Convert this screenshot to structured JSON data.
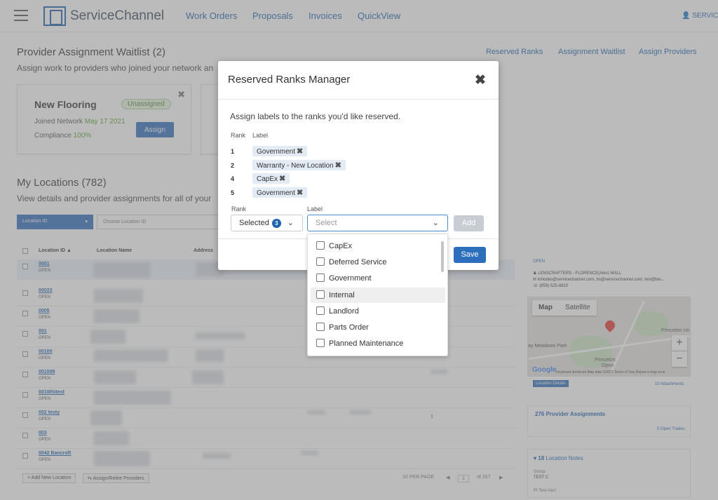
{
  "nav": {
    "logo": "ServiceChannel",
    "links": [
      "Work Orders",
      "Proposals",
      "Invoices",
      "QuickView"
    ],
    "user": "SERVICE"
  },
  "page": {
    "title": "Provider Assignment Waitlist (2)",
    "subtitle": "Assign work to providers who joined your network an",
    "top_links": [
      "Reserved Ranks",
      "Assignment Waitlist",
      "Assign Providers"
    ]
  },
  "waitlist_card": {
    "title": "New Flooring",
    "badge": "Unassigned",
    "close": "✖",
    "joined_label": "Joined Network",
    "joined_date": "May 17 2021",
    "compliance_label": "Compliance",
    "compliance_value": "100%",
    "assign_label": "Assign"
  },
  "locations": {
    "title": "My Locations (782)",
    "subtitle": "View details and provider assignments for all of your",
    "filter_field": "Location ID",
    "filter_placeholder": "Choose Location ID",
    "headers": [
      "Location ID ▲",
      "Location Name",
      "Address"
    ],
    "rows": [
      {
        "id": "0001",
        "status": "OPEN"
      },
      {
        "id": "00023",
        "status": "OPEN"
      },
      {
        "id": "0005",
        "status": "OPEN"
      },
      {
        "id": "001",
        "status": "OPEN"
      },
      {
        "id": "00100",
        "status": "OPEN"
      },
      {
        "id": "001008",
        "status": "OPEN"
      },
      {
        "id": "001Whitest",
        "status": "OPEN"
      },
      {
        "id": "002 testy",
        "status": "OPEN"
      },
      {
        "id": "003",
        "status": "OPEN"
      },
      {
        "id": "0042 Bancroft",
        "status": "OPEN"
      }
    ],
    "row_number": "1",
    "add_location": "Add New Location",
    "assign_retire": "Assign/Retire Providers",
    "per_page": "10  PER PAGE",
    "page_current": "1",
    "page_total": "of 257"
  },
  "right_panel": {
    "status": "OPEN",
    "name": "LENSCRAFTERS - FLORENCE(Alex) MALL",
    "emails": "krhodes@servicechannel.com, bs@servicechannel.com, test@tes...",
    "phone": "(859) 525-8810",
    "map": {
      "tab_map": "Map",
      "tab_satellite": "Satellite",
      "label_meadows": "ay Meadows Park",
      "label_princeton": "Princeton Un",
      "label_princeton2": "Princeton",
      "label_open": "Open",
      "google": "Google",
      "attribution": "Keyboard shortcuts   Map data ©2022   Terms of Use   Report a map error",
      "zoom_in": "+",
      "zoom_out": "−"
    },
    "location_details": "Location Details",
    "attachments": "10 Attachments",
    "provider_assignments": "276  Provider Assignments",
    "open_trades": "0 Open Trades",
    "notes_count": "18",
    "notes_label": "Location Notes",
    "group_label": "Group",
    "group_value": "TEST C",
    "pt_label": "PI Test Alert"
  },
  "modal": {
    "title": "Reserved Ranks Manager",
    "close": "✖",
    "intro": "Assign labels to the ranks you'd like reserved.",
    "col_rank": "Rank",
    "col_label": "Label",
    "reserved": [
      {
        "rank": "1",
        "label": "Government"
      },
      {
        "rank": "2",
        "label": "Warranty - New Location"
      },
      {
        "rank": "4",
        "label": "CapEx"
      },
      {
        "rank": "5",
        "label": "Government"
      }
    ],
    "rank_field_label": "Rank",
    "label_field_label": "Label",
    "rank_value": "Selected",
    "rank_count": "3",
    "label_placeholder": "Select",
    "add_label": "Add",
    "save_label": "Save"
  },
  "dropdown": {
    "options": [
      "CapEx",
      "Deferred Service",
      "Government",
      "Internal",
      "Landlord",
      "Parts Order",
      "Planned Maintenance"
    ],
    "hovered": "Internal"
  },
  "colors": {
    "primary": "#2e6fbd",
    "link": "#1e62b0",
    "chip": "#e3ebf5",
    "green": "#5aa02c"
  }
}
